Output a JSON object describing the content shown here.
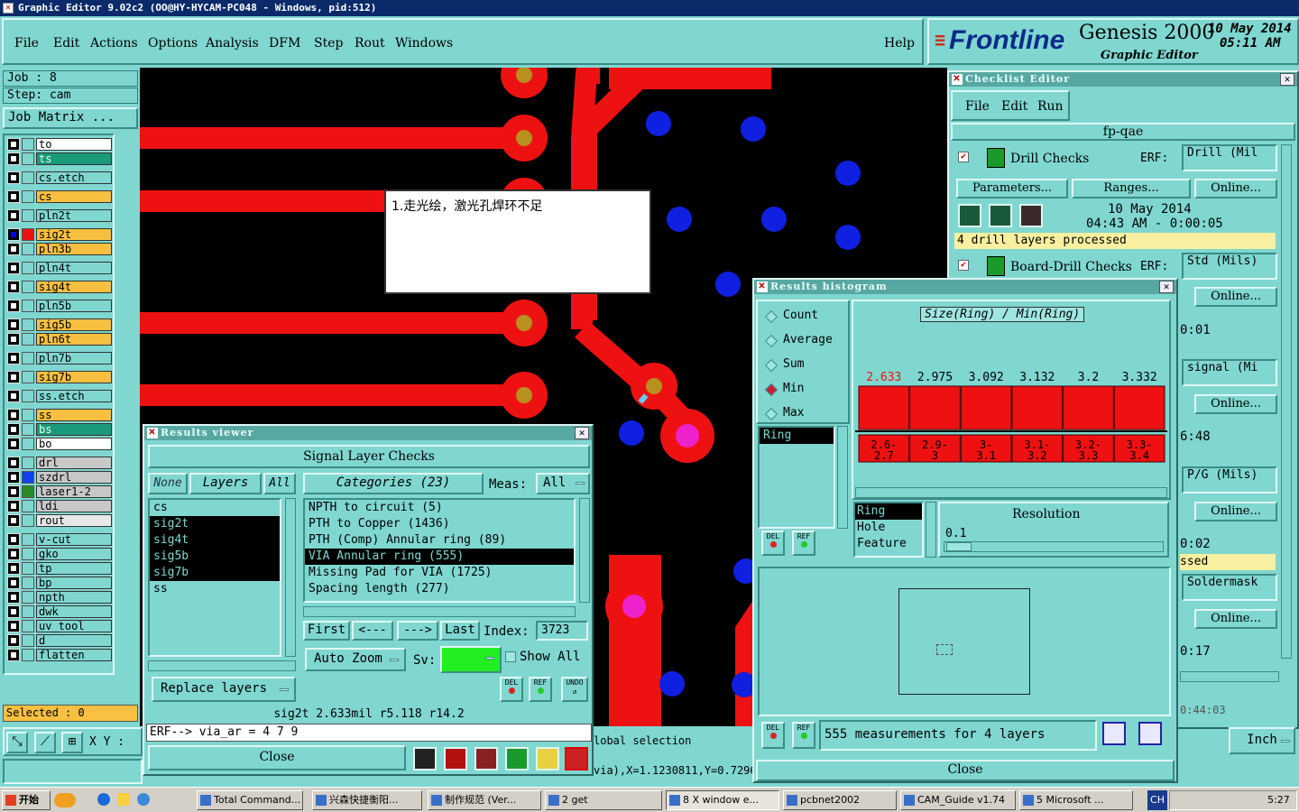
{
  "window": {
    "title": "Graphic Editor 9.02c2 (OO@HY-HYCAM-PC048 - Windows, pid:512)"
  },
  "menu": [
    "File",
    "Edit",
    "Actions",
    "Options",
    "Analysis",
    "DFM",
    "Step",
    "Rout",
    "Windows"
  ],
  "help": "Help",
  "logo": {
    "brand": "Frontline",
    "product": "Genesis 2000",
    "sub": "Graphic Editor",
    "date": "10 May 2014",
    "time": "05:11 AM"
  },
  "job": {
    "job": "Job  :  8",
    "step": "Step:  cam",
    "matrix": "Job Matrix ..."
  },
  "layers": [
    {
      "name": "to",
      "color": "#ffffff"
    },
    {
      "name": "ts",
      "color": "#1a9a7a"
    },
    {
      "name": "cs.etch",
      "color": "#7fd7d0"
    },
    {
      "name": "cs",
      "color": "#f8c040"
    },
    {
      "name": "pln2t",
      "color": "#7fd7d0"
    },
    {
      "name": "sig2t",
      "color": "#f8c040"
    },
    {
      "name": "pln3b",
      "color": "#f8c040"
    },
    {
      "name": "pln4t",
      "color": "#7fd7d0"
    },
    {
      "name": "sig4t",
      "color": "#f8c040"
    },
    {
      "name": "pln5b",
      "color": "#7fd7d0"
    },
    {
      "name": "sig5b",
      "color": "#f8c040"
    },
    {
      "name": "pln6t",
      "color": "#f8c040"
    },
    {
      "name": "pln7b",
      "color": "#7fd7d0"
    },
    {
      "name": "sig7b",
      "color": "#f8c040"
    },
    {
      "name": "ss.etch",
      "color": "#7fd7d0"
    },
    {
      "name": "ss",
      "color": "#f8c040"
    },
    {
      "name": "bs",
      "color": "#1a9a7a"
    },
    {
      "name": "bo",
      "color": "#ffffff"
    },
    {
      "name": "drl",
      "color": "#c8c8c8"
    },
    {
      "name": "szdrl",
      "color": "#c8c8c8"
    },
    {
      "name": "laser1-2",
      "color": "#c8c8c8"
    },
    {
      "name": "ldi",
      "color": "#c8c8c8"
    },
    {
      "name": "rout",
      "color": "#e8e8e8"
    },
    {
      "name": "v-cut",
      "color": "#7fd7d0"
    },
    {
      "name": "gko",
      "color": "#7fd7d0"
    },
    {
      "name": "tp",
      "color": "#7fd7d0"
    },
    {
      "name": "bp",
      "color": "#7fd7d0"
    },
    {
      "name": "npth",
      "color": "#7fd7d0"
    },
    {
      "name": "dwk",
      "color": "#7fd7d0"
    },
    {
      "name": "uv_tool",
      "color": "#7fd7d0"
    },
    {
      "name": "d",
      "color": "#7fd7d0"
    },
    {
      "name": "flatten",
      "color": "#7fd7d0"
    }
  ],
  "selected": "Selected : 0",
  "xy_label": "X Y :",
  "annotation": "1.走光绘，激光孔焊环不足",
  "results_viewer": {
    "title": "Results viewer",
    "header": "Signal Layer Checks",
    "none": "None",
    "layers": "Layers",
    "all": "All",
    "categories": "Categories (23)",
    "meas_label": "Meas:",
    "meas_value": "All",
    "layer_list": [
      {
        "name": "cs",
        "sel": false
      },
      {
        "name": "sig2t",
        "sel": true
      },
      {
        "name": "sig4t",
        "sel": true
      },
      {
        "name": "sig5b",
        "sel": true
      },
      {
        "name": "sig7b",
        "sel": true
      },
      {
        "name": "ss",
        "sel": false
      }
    ],
    "category_list": [
      {
        "name": "NPTH to circuit (5)",
        "sel": false
      },
      {
        "name": "PTH to Copper (1436)",
        "sel": false
      },
      {
        "name": "PTH (Comp) Annular ring (89)",
        "sel": false
      },
      {
        "name": "VIA Annular ring (555)",
        "sel": true
      },
      {
        "name": "Missing Pad for VIA (1725)",
        "sel": false
      },
      {
        "name": "Spacing length (277)",
        "sel": false
      }
    ],
    "first": "First",
    "prev": "<---",
    "next": "--->",
    "last": "Last",
    "index_label": "Index:",
    "index_value": "3723",
    "auto_zoom": "Auto Zoom",
    "sv": "Sv:",
    "show_all": "Show All",
    "replace_layers": "Replace layers",
    "del": "DEL",
    "ref": "REF",
    "undo": "UNDO",
    "status": "sig2t 2.633mil   r5.118   r14.2",
    "erf": "ERF--> via_ar = 4 7 9",
    "close": "Close"
  },
  "histogram": {
    "title": "Results histogram",
    "modes": [
      "Count",
      "Average",
      "Sum",
      "Min",
      "Max"
    ],
    "active_mode": "Min",
    "chart_title": "Size(Ring) / Min(Ring)",
    "list": [
      "Ring"
    ],
    "measures": [
      "Ring",
      "Hole",
      "Feature"
    ],
    "resolution_label": "Resolution",
    "resolution_value": "0.1",
    "del": "DEL",
    "ref": "REF",
    "summary": "555 measurements for 4 layers",
    "close": "Close"
  },
  "chart_data": {
    "type": "bar",
    "title": "Size(Ring) / Min(Ring)",
    "categories": [
      "2.6-2.7",
      "2.9-3",
      "3-3.1",
      "3.1-3.2",
      "3.2-3.3",
      "3.3-3.4"
    ],
    "values": [
      2.633,
      2.975,
      3.092,
      3.132,
      3.2,
      3.332
    ],
    "bar_color": "#ee1111",
    "highlight_first": true
  },
  "checklist": {
    "title": "Checklist Editor",
    "menu": [
      "File",
      "Edit",
      "Run"
    ],
    "name": "fp-qae",
    "drill_checks": "Drill Checks",
    "erf": "ERF:",
    "drill_erf": "Drill (Mil",
    "parameters": "Parameters...",
    "ranges": "Ranges...",
    "online": "Online...",
    "run_date": "10 May 2014",
    "run_time": "04:43 AM - 0:00:05",
    "processed": "4 drill layers processed",
    "board_drill": "Board-Drill Checks",
    "board_erf": "Std (Mils)",
    "side_times": [
      "0:01",
      "6:48",
      "0:02",
      "0:17"
    ],
    "side_erfs": [
      "signal (Mi",
      "P/G (Mils)",
      "Soldermask"
    ],
    "side_text": "ssed",
    "side_bottom": "0:44:03"
  },
  "bottom": {
    "global_selection": "lobal selection",
    "coord": "via),X=1.1230811,Y=0.7296",
    "units": "Inch"
  },
  "taskbar": {
    "start": "开始",
    "tasks": [
      "Total Command...",
      "兴森快捷衡阳...",
      "制作规范 (Ver...",
      "2 get",
      "8 X window e...",
      "pcbnet2002",
      "CAM_Guide v1.74",
      "5 Microsoft ..."
    ],
    "lang": "CH",
    "clock": "5:27"
  }
}
